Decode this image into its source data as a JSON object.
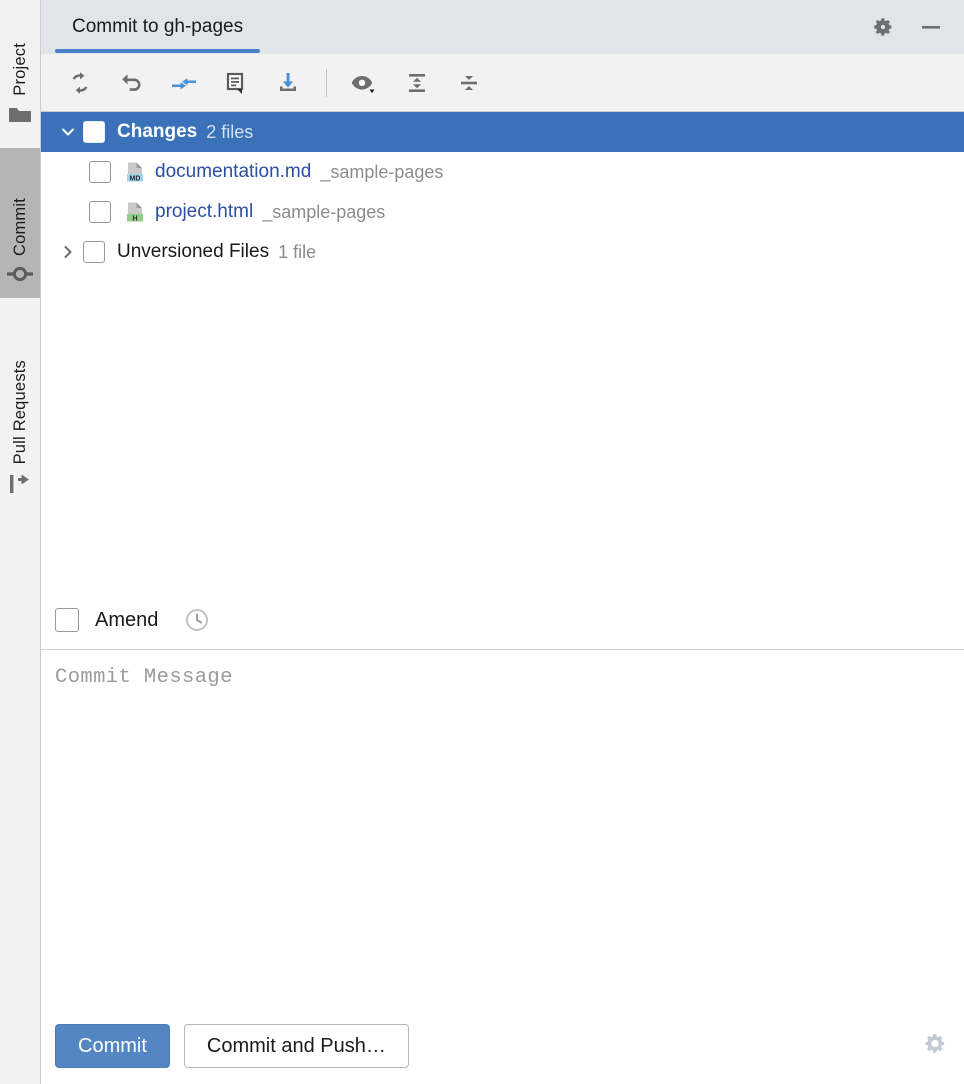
{
  "sidebar": {
    "tabs": [
      {
        "label": "Project",
        "icon": "folder-icon",
        "active": false
      },
      {
        "label": "Commit",
        "icon": "commit-node-icon",
        "active": true
      },
      {
        "label": "Pull Requests",
        "icon": "pull-request-icon",
        "active": false
      }
    ]
  },
  "header": {
    "tab_title": "Commit to gh-pages",
    "settings_icon": "gear-icon",
    "minimize_icon": "minimize-icon",
    "accent_color": "#4a81c4"
  },
  "toolbar": {
    "buttons": [
      {
        "name": "refresh-changes-button",
        "icon": "refresh-icon",
        "tint": "#6e6e6e"
      },
      {
        "name": "rollback-button",
        "icon": "undo-icon",
        "tint": "#6e6e6e"
      },
      {
        "name": "shelve-changes-button",
        "icon": "shelve-arrows-icon",
        "tint": "#4a90d9"
      },
      {
        "name": "show-diff-button",
        "icon": "diff-comment-icon",
        "tint": "#6e6e6e"
      },
      {
        "name": "update-project-button",
        "icon": "download-icon",
        "tint": "#6e6e6e"
      },
      {
        "name": "view-options-button",
        "icon": "eye-dropdown-icon",
        "tint": "#6e6e6e"
      },
      {
        "name": "expand-all-button",
        "icon": "expand-all-icon",
        "tint": "#6e6e6e"
      },
      {
        "name": "collapse-all-button",
        "icon": "collapse-all-icon",
        "tint": "#6e6e6e"
      }
    ]
  },
  "changes_tree": {
    "groups": [
      {
        "name": "Changes",
        "count_label": "2 files",
        "expanded": true,
        "selected": true,
        "checked": false,
        "files": [
          {
            "filename": "documentation.md",
            "path": "_sample-pages",
            "ext_badge": "MD",
            "badge_color": "#9fd4ec",
            "checked": false
          },
          {
            "filename": "project.html",
            "path": "_sample-pages",
            "ext_badge": "H",
            "badge_color": "#8fce87",
            "checked": false
          }
        ]
      },
      {
        "name": "Unversioned Files",
        "count_label": "1 file",
        "expanded": false,
        "selected": false,
        "checked": false,
        "files": []
      }
    ]
  },
  "amend": {
    "label": "Amend",
    "checked": false,
    "history_icon": "clock-history-icon"
  },
  "commit_message": {
    "value": "",
    "placeholder": "Commit Message"
  },
  "actions": {
    "commit_label": "Commit",
    "commit_and_push_label": "Commit and Push…",
    "settings_icon": "gear-icon",
    "primary_color": "#5486c4"
  }
}
